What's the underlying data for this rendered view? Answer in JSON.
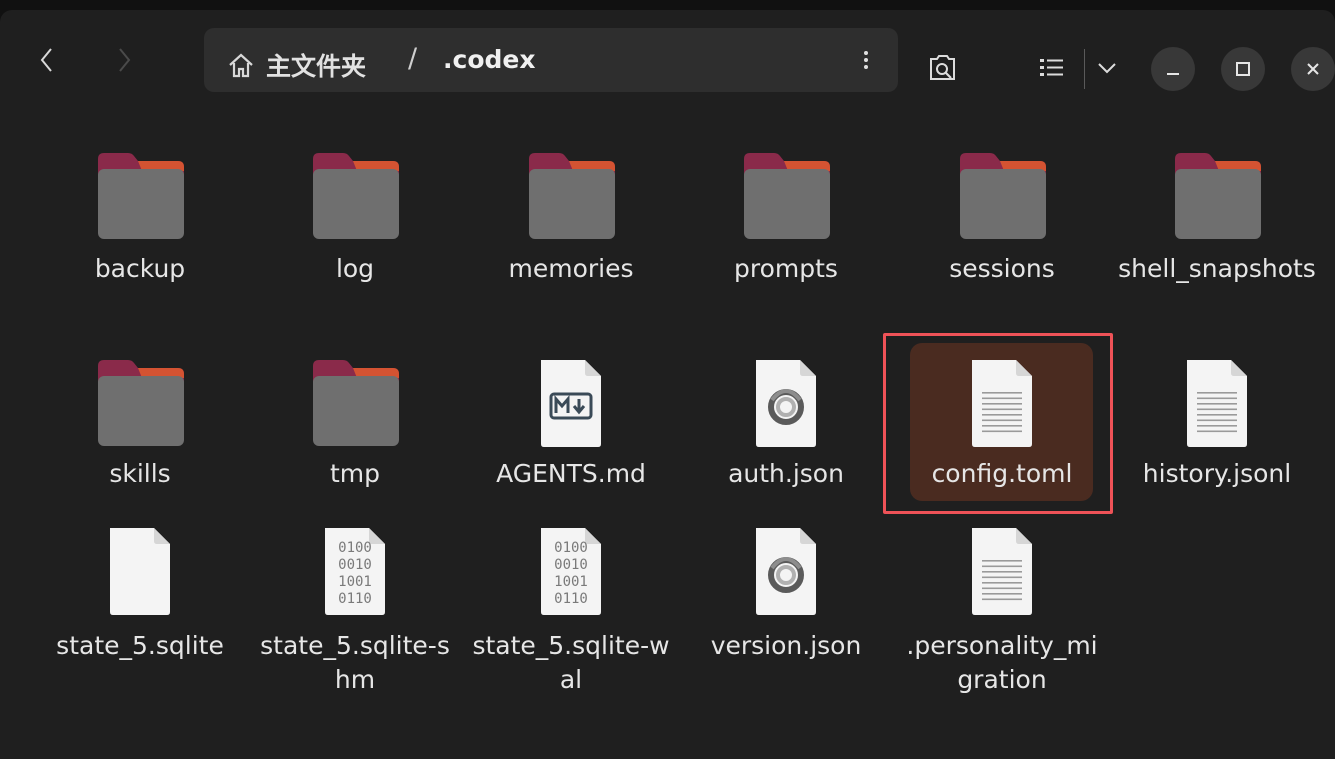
{
  "header": {
    "breadcrumb": {
      "home_label": "主文件夹",
      "separator": "/",
      "current": ".codex"
    },
    "icons": {
      "back": "chevron-left-icon",
      "forward": "chevron-right-icon",
      "home": "home-icon",
      "path_menu": "vertical-dots-icon",
      "search": "search-icon",
      "view_list": "list-view-icon",
      "view_options": "chevron-down-icon",
      "minimize": "minimize-icon",
      "maximize": "maximize-icon",
      "close": "close-icon"
    }
  },
  "colors": {
    "folder_body": "#6f6f6f",
    "folder_tab": "#8a2a4a",
    "folder_tab_accent": "#e15a2e",
    "selection_bg": "#4a2b20",
    "selection_outline": "#ee5257"
  },
  "files": [
    {
      "name": "backup",
      "type": "folder",
      "icon": "folder-icon"
    },
    {
      "name": "log",
      "type": "folder",
      "icon": "folder-icon"
    },
    {
      "name": "memories",
      "type": "folder",
      "icon": "folder-icon"
    },
    {
      "name": "prompts",
      "type": "folder",
      "icon": "folder-icon"
    },
    {
      "name": "sessions",
      "type": "folder",
      "icon": "folder-icon"
    },
    {
      "name": "shell_snapshots",
      "type": "folder",
      "icon": "folder-icon"
    },
    {
      "name": "skills",
      "type": "folder",
      "icon": "folder-icon"
    },
    {
      "name": "tmp",
      "type": "folder",
      "icon": "folder-icon"
    },
    {
      "name": "AGENTS.md",
      "type": "markdown",
      "icon": "markdown-file-icon"
    },
    {
      "name": "auth.json",
      "type": "json",
      "icon": "json-file-icon"
    },
    {
      "name": "config.toml",
      "type": "text",
      "icon": "text-file-icon",
      "selected": true
    },
    {
      "name": "history.jsonl",
      "type": "text",
      "icon": "text-file-icon"
    },
    {
      "name": "state_5.sqlite",
      "type": "blank",
      "icon": "blank-file-icon"
    },
    {
      "name": "state_5.sqlite-shm",
      "type": "binary",
      "icon": "binary-file-icon"
    },
    {
      "name": "state_5.sqlite-wal",
      "type": "binary",
      "icon": "binary-file-icon"
    },
    {
      "name": "version.json",
      "type": "json",
      "icon": "json-file-icon"
    },
    {
      "name": ".personality_migration",
      "type": "text",
      "icon": "text-file-icon"
    }
  ]
}
